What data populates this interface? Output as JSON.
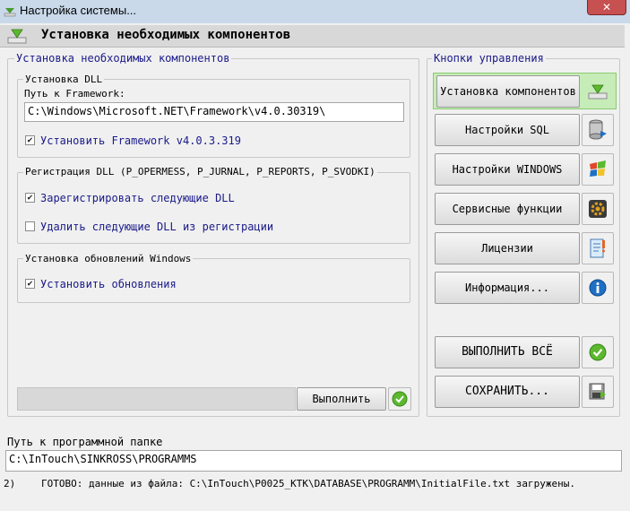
{
  "window": {
    "title": "Настройка системы...",
    "close_label": "✕"
  },
  "header": {
    "title": "Установка необходимых компонентов"
  },
  "left_panel": {
    "legend": "Установка необходимых компонентов",
    "dll_group": {
      "legend": "Установка DLL",
      "framework_path_label": "Путь к Framework:",
      "framework_path_value": "C:\\Windows\\Microsoft.NET\\Framework\\v4.0.30319\\",
      "install_framework": {
        "label": "Установить Framework v4.0.3.319",
        "checked": true
      }
    },
    "reg_group": {
      "legend": "Регистрация DLL  (P_OPERMESS, P_JURNAL, P_REPORTS, P_SVODKI)",
      "register": {
        "label": "Зарегистрировать следующие DLL",
        "checked": true
      },
      "unregister": {
        "label": "Удалить следующие DLL из регистрации",
        "checked": false
      }
    },
    "updates_group": {
      "legend": "Установка обновлений Windows",
      "install_updates": {
        "label": "Установить обновления",
        "checked": true
      }
    },
    "execute_button": "Выполнить"
  },
  "right_panel": {
    "legend": "Кнопки управления",
    "buttons": [
      {
        "label": "Установка компонентов",
        "icon": "install-icon",
        "active": true
      },
      {
        "label": "Настройки SQL",
        "icon": "database-icon",
        "active": false
      },
      {
        "label": "Настройки WINDOWS",
        "icon": "windows-icon",
        "active": false
      },
      {
        "label": "Сервисные функции",
        "icon": "service-icon",
        "active": false
      },
      {
        "label": "Лицензии",
        "icon": "license-icon",
        "active": false
      },
      {
        "label": "Информация...",
        "icon": "info-icon",
        "active": false
      }
    ],
    "execute_all": "ВЫПОЛНИТЬ ВСЁ",
    "save": "СОХРАНИТЬ..."
  },
  "program_path": {
    "label": "Путь к программной папке",
    "value": "C:\\InTouch\\SINKROSS\\PROGRAMMS"
  },
  "status": {
    "index": "2)",
    "text": "ГОТОВО: данные из файла: C:\\InTouch\\P0025_KTK\\DATABASE\\PROGRAMM\\InitialFile.txt загружены."
  },
  "colors": {
    "active_green": "#c6ecb8",
    "check_green": "#5cb82e",
    "info_blue": "#1f6fc4"
  }
}
